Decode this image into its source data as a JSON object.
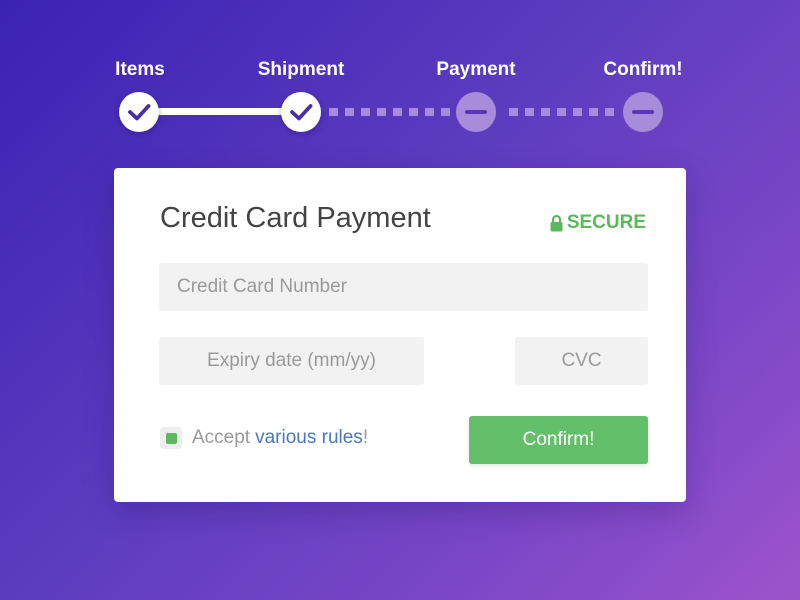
{
  "steps": [
    {
      "label": "Items",
      "status": "done",
      "icon": "check-icon"
    },
    {
      "label": "Shipment",
      "status": "done",
      "icon": "check-icon"
    },
    {
      "label": "Payment",
      "status": "pending",
      "icon": "minus-icon"
    },
    {
      "label": "Confirm!",
      "status": "pending",
      "icon": "minus-icon"
    }
  ],
  "card": {
    "title": "Credit Card Payment",
    "secure_label": "SECURE",
    "card_number_placeholder": "Credit Card Number",
    "expiry_placeholder": "Expiry date (mm/yy)",
    "cvc_placeholder": "CVC",
    "accept_prefix": "Accept",
    "accept_link": "various rules",
    "accept_suffix": "!",
    "accept_checked": true,
    "confirm_label": "Confirm!"
  },
  "colors": {
    "background_start": "#3a22b4",
    "background_end": "#9d54cb",
    "accent_green": "#5cb85c",
    "link_blue": "#4a78c0",
    "step_pending": "#a88cdc"
  }
}
